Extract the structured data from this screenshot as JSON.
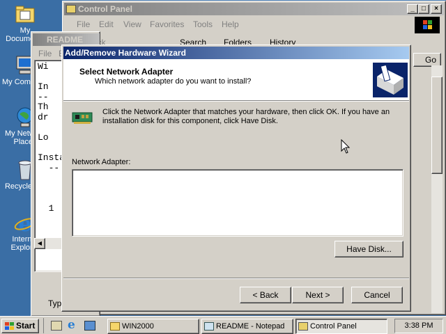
{
  "desktop": {
    "icons": [
      {
        "label": "My Documents",
        "icon": "my-documents-icon"
      },
      {
        "label": "My Computer",
        "icon": "my-computer-icon"
      },
      {
        "label": "My Network Places",
        "icon": "network-places-icon"
      },
      {
        "label": "Recycle Bin",
        "icon": "recycle-bin-icon"
      },
      {
        "label": "Internet Explorer",
        "icon": "internet-explorer-icon"
      }
    ]
  },
  "control_panel": {
    "title": "Control Panel",
    "menu": [
      "File",
      "Edit",
      "View",
      "Favorites",
      "Tools",
      "Help"
    ],
    "toolbar": {
      "back": "Back",
      "search": "Search",
      "folders": "Folders",
      "history": "History"
    },
    "go_label": "Go"
  },
  "notepad": {
    "title": "README",
    "menu": [
      "File",
      "E"
    ],
    "lines": [
      "Wi",
      "",
      "In",
      "--",
      "Th",
      "dr",
      "",
      "Lo",
      "",
      "Insta",
      "  --",
      "",
      "",
      "",
      "  1"
    ],
    "status": "Typ"
  },
  "wizard": {
    "title": "Add/Remove Hardware Wizard",
    "heading": "Select Network Adapter",
    "subheading": "Which network adapter do you want to install?",
    "instruction": "Click the Network Adapter that matches your hardware, then click OK. If you have an installation disk for this component, click Have Disk.",
    "list_label": "Network Adapter:",
    "have_disk": "Have Disk...",
    "back": "< Back",
    "next": "Next >",
    "cancel": "Cancel"
  },
  "taskbar": {
    "start": "Start",
    "tasks": [
      {
        "label": "WIN2000",
        "pressed": false
      },
      {
        "label": "README - Notepad",
        "pressed": false
      },
      {
        "label": "Control Panel",
        "pressed": true
      }
    ],
    "clock": "3:38 PM"
  }
}
